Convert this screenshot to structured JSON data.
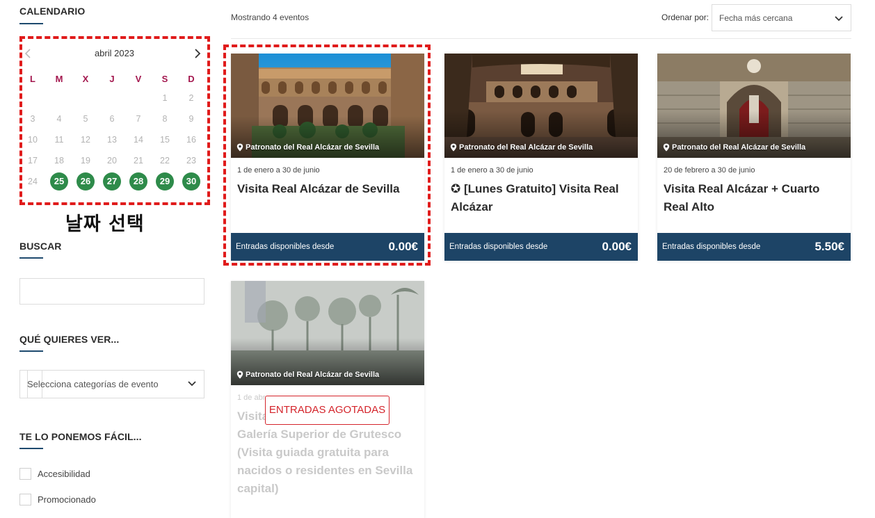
{
  "sidebar": {
    "calendar": {
      "title": "CALENDARIO",
      "month": "abril 2023",
      "weekdays": [
        "L",
        "M",
        "X",
        "J",
        "V",
        "S",
        "D"
      ],
      "days": [
        "1",
        "2",
        "3",
        "4",
        "5",
        "6",
        "7",
        "8",
        "9",
        "10",
        "11",
        "12",
        "13",
        "14",
        "15",
        "16",
        "17",
        "18",
        "19",
        "20",
        "21",
        "22",
        "23",
        "24",
        "25",
        "26",
        "27",
        "28",
        "29",
        "30"
      ],
      "available_days": [
        "25",
        "26",
        "27",
        "28",
        "29",
        "30"
      ],
      "accent_color": "#2e8b4a"
    },
    "annotation": "날짜 선택",
    "search": {
      "title": "BUSCAR",
      "value": ""
    },
    "category": {
      "title": "QUÉ QUIERES VER...",
      "placeholder": "Selecciona categorías de evento"
    },
    "easy": {
      "title": "TE LO PONEMOS FÁCIL...",
      "options": [
        {
          "label": "Accesibilidad",
          "checked": false
        },
        {
          "label": "Promocionado",
          "checked": false
        }
      ]
    }
  },
  "main": {
    "results_count": "Mostrando 4 eventos",
    "order": {
      "label": "Ordenar por:",
      "value": "Fecha más cercana"
    },
    "events": [
      {
        "location": "Patronato del Real Alcázar de Sevilla",
        "dates": "1 de enero a 30 de junio",
        "title": "Visita Real Alcázar de Sevilla",
        "price_label": "Entradas disponibles desde",
        "price": "0.00€"
      },
      {
        "location": "Patronato del Real Alcázar de Sevilla",
        "dates": "1 de enero a 30 de junio",
        "title": "✪ [Lunes Gratuito] Visita Real Alcázar",
        "price_label": "Entradas disponibles desde",
        "price": "0.00€"
      },
      {
        "location": "Patronato del Real Alcázar de Sevilla",
        "dates": "20 de febrero a 30 de junio",
        "title": "Visita Real Alcázar + Cuarto Real Alto",
        "price_label": "Entradas disponibles desde",
        "price": "5.50€"
      },
      {
        "location": "Patronato del Real Alcázar de Sevilla",
        "dates": "1 de abr",
        "title": "Visita Palacio Gótico y a la Galería Superior de Grutesco (Visita guiada gratuita para nacidos o residentes en Sevilla capital)",
        "status": "ENTRADAS AGOTADAS"
      }
    ],
    "footer_color": "#1d4466",
    "highlight_color": "#e01b1b"
  }
}
